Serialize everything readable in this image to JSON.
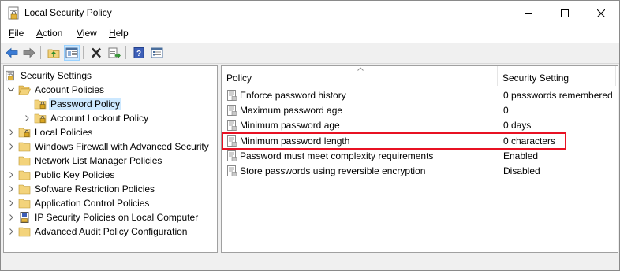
{
  "window": {
    "title": "Local Security Policy"
  },
  "menu": {
    "file_prefix": "",
    "file_hot": "F",
    "file_rest": "ile",
    "action_hot": "A",
    "action_rest": "ction",
    "view_hot": "V",
    "view_rest": "iew",
    "help_hot": "H",
    "help_rest": "elp"
  },
  "toolbar": {
    "buttons": [
      "back-icon",
      "forward-icon",
      "up-folder-icon",
      "show-hide-tree-icon",
      "delete-icon",
      "export-list-icon",
      "help-icon",
      "properties-icon"
    ]
  },
  "tree": {
    "root": "Security Settings",
    "items": [
      {
        "label": "Account Policies",
        "expanded": true
      },
      {
        "label": "Password Policy",
        "selected": true
      },
      {
        "label": "Account Lockout Policy"
      },
      {
        "label": "Local Policies"
      },
      {
        "label": "Windows Firewall with Advanced Security"
      },
      {
        "label": "Network List Manager Policies"
      },
      {
        "label": "Public Key Policies"
      },
      {
        "label": "Software Restriction Policies"
      },
      {
        "label": "Application Control Policies"
      },
      {
        "label": "IP Security Policies on Local Computer"
      },
      {
        "label": "Advanced Audit Policy Configuration"
      }
    ]
  },
  "list": {
    "col_policy": "Policy",
    "col_setting": "Security Setting",
    "rows": [
      {
        "policy": "Enforce password history",
        "setting": "0 passwords remembered"
      },
      {
        "policy": "Maximum password age",
        "setting": "0"
      },
      {
        "policy": "Minimum password age",
        "setting": "0 days"
      },
      {
        "policy": "Minimum password length",
        "setting": "0 characters"
      },
      {
        "policy": "Password must meet complexity requirements",
        "setting": "Enabled"
      },
      {
        "policy": "Store passwords using reversible encryption",
        "setting": "Disabled"
      }
    ],
    "highlighted_row": "Minimum password length"
  },
  "colors": {
    "highlight_border": "#e81123",
    "selection": "#cce8ff",
    "folder": "#f3d37b"
  }
}
